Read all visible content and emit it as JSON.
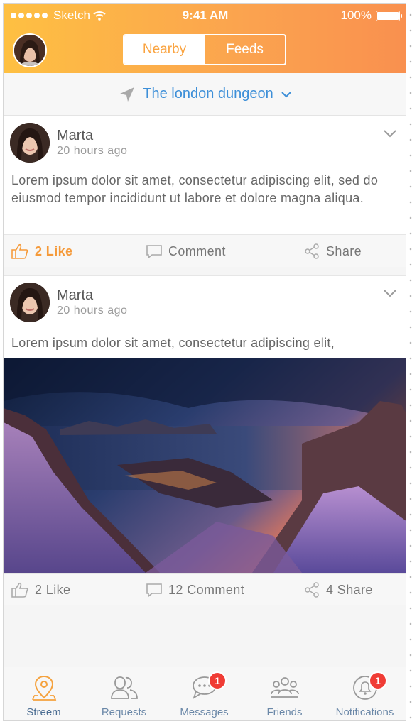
{
  "status_bar": {
    "carrier": "Sketch",
    "time": "9:41 AM",
    "battery": "100%"
  },
  "header": {
    "segments": [
      {
        "label": "Nearby",
        "active": true
      },
      {
        "label": "Feeds",
        "active": false
      }
    ],
    "accent_gradient": [
      "#fec042",
      "#f9904f"
    ]
  },
  "location": {
    "label": "The london dungeon",
    "color": "#3d8fd8"
  },
  "posts": [
    {
      "author": "Marta",
      "time": "20 hours ago",
      "text": "Lorem ipsum dolor sit amet, consectetur adipiscing elit, sed do eiusmod tempor incididunt ut labore et dolore magna aliqua.",
      "actions": {
        "like": "2 Like",
        "comment": "Comment",
        "share": "Share"
      },
      "liked": true
    },
    {
      "author": "Marta",
      "time": "20 hours ago",
      "text": "Lorem ipsum dolor sit amet, consectetur adipiscing elit,",
      "image": "landscape-photo-sunset-mountains",
      "actions": {
        "like": "2 Like",
        "comment": "12 Comment",
        "share": "4 Share"
      },
      "liked": false
    }
  ],
  "tabbar": {
    "items": [
      {
        "label": "Streem",
        "icon": "location-pin-icon",
        "active": true
      },
      {
        "label": "Requests",
        "icon": "users-icon",
        "active": false
      },
      {
        "label": "Messages",
        "icon": "chat-bubble-icon",
        "badge": "1",
        "active": false
      },
      {
        "label": "Friends",
        "icon": "friends-icon",
        "active": false
      },
      {
        "label": "Notifications",
        "icon": "bell-icon",
        "badge": "1",
        "active": false
      }
    ]
  },
  "colors": {
    "like_active": "#f59a3a",
    "badge": "#f03c35",
    "tab_label": "#6b88a8"
  }
}
